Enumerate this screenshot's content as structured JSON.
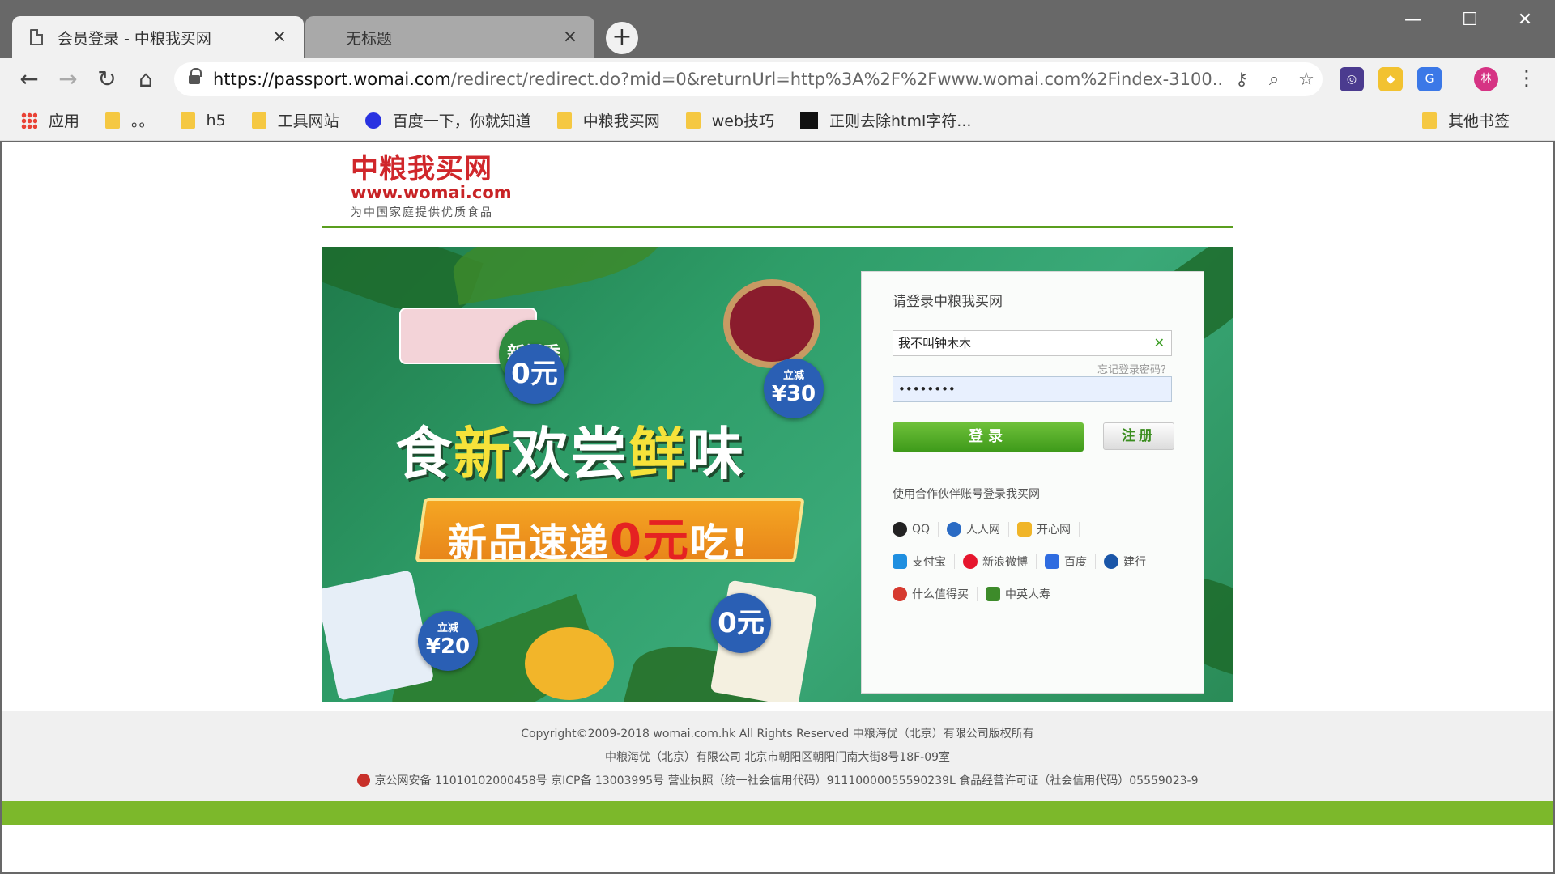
{
  "browser": {
    "tabs": [
      {
        "title": "会员登录 - 中粮我买网",
        "active": true
      },
      {
        "title": "无标题",
        "active": false
      }
    ],
    "url_host": "https://passport.womai.com",
    "url_path": "/redirect/redirect.do?mid=0&returnUrl=http%3A%2F%2Fwww.womai.com%2Findex-3100...",
    "avatar_initial": "林",
    "bookmarks": [
      {
        "label": "应用",
        "icon": "apps-icon"
      },
      {
        "label": "。。",
        "icon": "folder-icon"
      },
      {
        "label": "h5",
        "icon": "folder-icon"
      },
      {
        "label": "工具网站",
        "icon": "folder-icon"
      },
      {
        "label": "百度一下，你就知道",
        "icon": "baidu-icon"
      },
      {
        "label": "中粮我买网",
        "icon": "folder-icon"
      },
      {
        "label": "web技巧",
        "icon": "folder-icon"
      },
      {
        "label": "正则去除html字符...",
        "icon": "site-icon"
      }
    ],
    "other_bookmarks": "其他书签"
  },
  "header": {
    "logo_cn": "中粮我买网",
    "logo_en": "www.womai.com",
    "logo_sub": "为中国家庭提供优质食品"
  },
  "banner": {
    "headline_a": "食",
    "headline_b": "新",
    "headline_c": "欢尝",
    "headline_d": "鲜",
    "headline_e": "味",
    "sub_a": "新品速递",
    "sub_b": "0元",
    "sub_c": "吃!",
    "badge_zero": "0元",
    "badge_reduce_label": "立减",
    "badge_reduce_30": "¥30",
    "badge_reduce_20": "¥20",
    "badge_fresh": "新鲜季"
  },
  "login": {
    "title": "请登录中粮我买网",
    "username_value": "我不叫钟木木",
    "password_value": "••••••••",
    "forgot": "忘记登录密码？",
    "login_button": "登录",
    "register_button": "注册",
    "partner_title": "使用合作伙伴账号登录我买网",
    "partners": [
      [
        {
          "label": "QQ",
          "color": "#222222"
        },
        {
          "label": "人人网",
          "color": "#2a6bc4"
        },
        {
          "label": "开心网",
          "color": "#f0b528"
        }
      ],
      [
        {
          "label": "支付宝",
          "color": "#1f8fe0"
        },
        {
          "label": "新浪微博",
          "color": "#e6162d"
        },
        {
          "label": "百度",
          "color": "#2f6ce0"
        },
        {
          "label": "建行",
          "color": "#1a56a8"
        }
      ],
      [
        {
          "label": "什么值得买",
          "color": "#d63a2f"
        },
        {
          "label": "中英人寿",
          "color": "#3d8b2a"
        }
      ]
    ]
  },
  "footer": {
    "line1": "Copyright©2009-2018 womai.com.hk All Rights Reserved 中粮海优（北京）有限公司版权所有",
    "line2": "中粮海优（北京）有限公司 北京市朝阳区朝阳门南大街8号18F-09室",
    "line3": "京公网安备 11010102000458号   京ICP备 13003995号 营业执照（统一社会信用代码）91110000055590239L 食品经营许可证（社会信用代码）05559023-9"
  }
}
